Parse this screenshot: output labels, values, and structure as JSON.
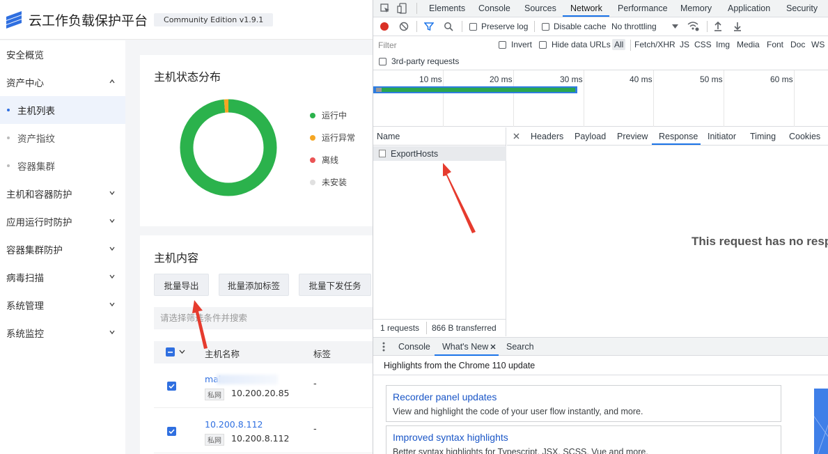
{
  "app": {
    "title": "云工作负载保护平台",
    "edition": "Community Edition v1.9.1",
    "sidebar": [
      {
        "label": "安全概览",
        "type": "top"
      },
      {
        "label": "资产中心",
        "type": "top",
        "chevron": "up"
      },
      {
        "label": "主机列表",
        "type": "sub",
        "active": true
      },
      {
        "label": "资产指纹",
        "type": "sub"
      },
      {
        "label": "容器集群",
        "type": "sub"
      },
      {
        "label": "主机和容器防护",
        "type": "top",
        "chevron": "down"
      },
      {
        "label": "应用运行时防护",
        "type": "top",
        "chevron": "down"
      },
      {
        "label": "容器集群防护",
        "type": "top",
        "chevron": "down"
      },
      {
        "label": "病毒扫描",
        "type": "top",
        "chevron": "down"
      },
      {
        "label": "系统管理",
        "type": "top",
        "chevron": "down"
      },
      {
        "label": "系统监控",
        "type": "top",
        "chevron": "down"
      }
    ],
    "status_card": {
      "title": "主机状态分布",
      "legend": [
        {
          "label": "运行中",
          "color": "#2bb24c",
          "value": 0.985
        },
        {
          "label": "运行异常",
          "color": "#f5a623",
          "value": 0.015
        },
        {
          "label": "离线",
          "color": "#ea5455",
          "value": 0
        },
        {
          "label": "未安装",
          "color": "#e0e0e0",
          "value": 0
        }
      ]
    },
    "content_card": {
      "title": "主机内容",
      "buttons": [
        "批量导出",
        "批量添加标签",
        "批量下发任务"
      ],
      "search_placeholder": "请选择筛选条件并搜索",
      "columns": [
        "主机名称",
        "标签"
      ],
      "rows": [
        {
          "name": "mai",
          "ip_tag": "私网",
          "ip": "10.200.20.85",
          "tag": "-"
        },
        {
          "name": "10.200.8.112",
          "ip_tag": "私网",
          "ip": "10.200.8.112",
          "tag": "-"
        }
      ]
    }
  },
  "devtools": {
    "tabs": [
      "Elements",
      "Console",
      "Sources",
      "Network",
      "Performance",
      "Memory",
      "Application",
      "Security"
    ],
    "active_tab": "Network",
    "toolbar": {
      "preserve_log": "Preserve log",
      "disable_cache": "Disable cache",
      "throttling": "No throttling"
    },
    "filter": {
      "placeholder": "Filter",
      "invert": "Invert",
      "hide_data_urls": "Hide data URLs",
      "types": [
        "All",
        "Fetch/XHR",
        "JS",
        "CSS",
        "Img",
        "Media",
        "Font",
        "Doc",
        "WS"
      ],
      "third_party": "3rd-party requests"
    },
    "timeline_ticks": [
      "10 ms",
      "20 ms",
      "30 ms",
      "40 ms",
      "50 ms",
      "60 ms"
    ],
    "list": {
      "header": "Name",
      "requests": [
        {
          "name": "ExportHosts"
        }
      ],
      "footer_requests": "1 requests",
      "footer_transferred": "866 B transferred"
    },
    "detail_tabs": [
      "Headers",
      "Payload",
      "Preview",
      "Response",
      "Initiator",
      "Timing",
      "Cookies"
    ],
    "active_detail_tab": "Response",
    "no_response_text": "This request has no response data available.",
    "drawer": {
      "tabs": [
        "Console",
        "What's New",
        "Search"
      ],
      "active": "What's New",
      "highlights": "Highlights from the Chrome 110 update",
      "cards": [
        {
          "title": "Recorder panel updates",
          "desc": "View and highlight the code of your user flow instantly, and more."
        },
        {
          "title": "Improved syntax highlights",
          "desc": "Better syntax highlights for Typescript, JSX, SCSS, Vue and more."
        }
      ]
    }
  }
}
